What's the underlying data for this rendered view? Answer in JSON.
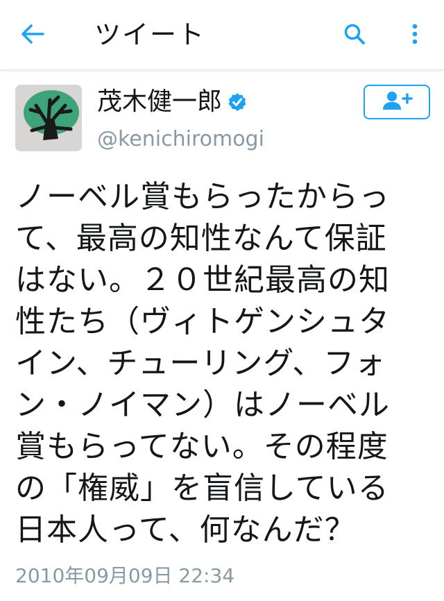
{
  "header": {
    "title": "ツイート",
    "back_icon": "arrow-left-icon",
    "search_icon": "search-icon",
    "more_icon": "more-vertical-icon",
    "accent_color": "#1da1f2"
  },
  "tweet": {
    "author": {
      "name": "茂木健一郎",
      "handle": "@kenichiromogi",
      "verified": true,
      "avatar_icon": "deer-drawing-avatar"
    },
    "follow_icon": "follow-user-plus-icon",
    "text_lines": [
      "ノーベル賞もらったからっ",
      "て、最高の知性なんて保証",
      "はない。２０世紀最高の知",
      "性たち（ヴィトゲンシュタ",
      "イン、チューリング、フォ",
      "ン・ノイマン）はノーベル",
      "賞もらってない。その程度",
      "の「権威」を盲信している",
      "日本人って、何なんだ？"
    ],
    "timestamp": "2010年09月09日 22:34"
  }
}
